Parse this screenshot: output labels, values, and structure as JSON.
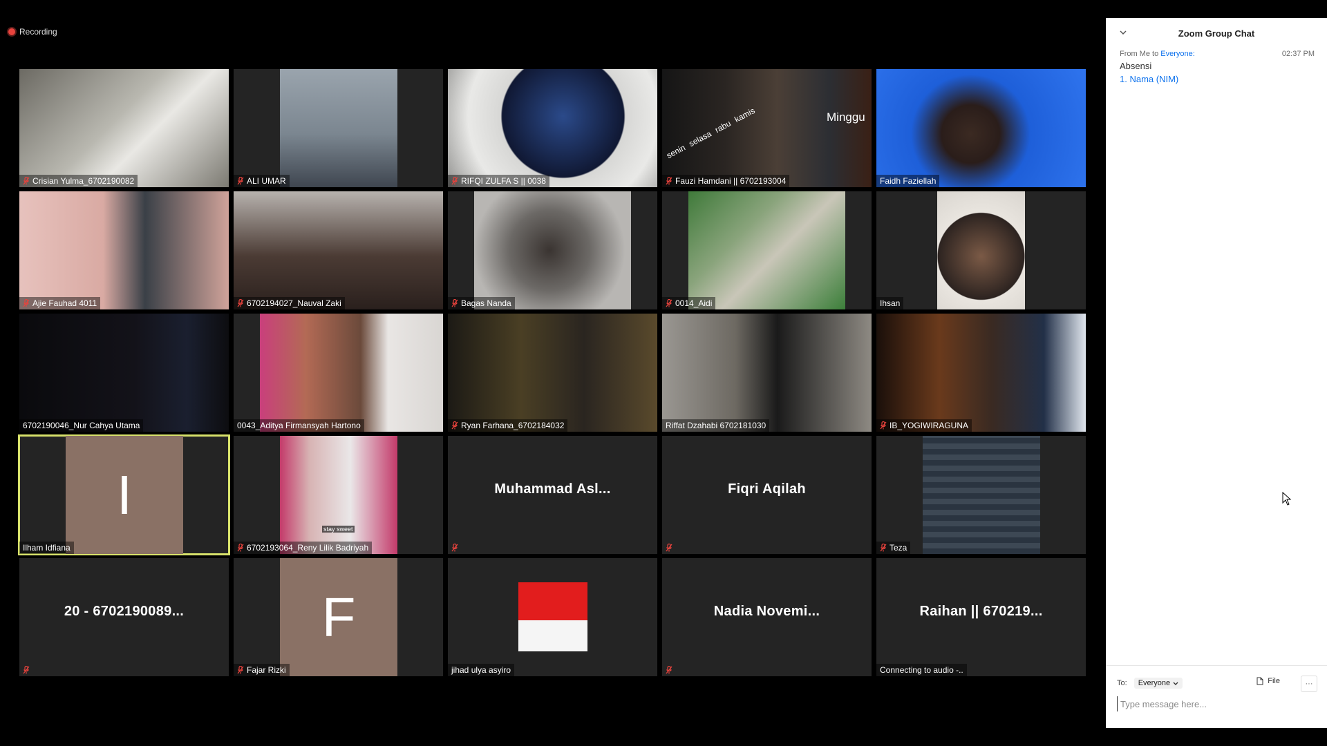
{
  "recording": {
    "label": "Recording"
  },
  "tiles": [
    {
      "name": "Crisian Yulma_6702190082",
      "muted": true
    },
    {
      "name": "ALI UMAR",
      "muted": true
    },
    {
      "name": "RIFQI ZULFA S || 0038",
      "muted": true
    },
    {
      "name": "Fauzi Hamdani || 6702193004",
      "muted": true
    },
    {
      "name": "Faidh Faziellah",
      "muted": false
    },
    {
      "name": "Ajie Fauhad 4011",
      "muted": true
    },
    {
      "name": "6702194027_Nauval Zaki",
      "muted": true
    },
    {
      "name": "Bagas Nanda",
      "muted": true
    },
    {
      "name": "0014_Aidi",
      "muted": true
    },
    {
      "name": "Ihsan",
      "muted": false
    },
    {
      "name": "6702190046_Nur Cahya Utama",
      "muted": false
    },
    {
      "name": "0043_Aditya Firmansyah Hartono",
      "muted": false
    },
    {
      "name": "Ryan Farhana_6702184032",
      "muted": true
    },
    {
      "name": "Riffat Dzahabi 6702181030",
      "muted": false
    },
    {
      "name": "IB_YOGIWIRAGUNA",
      "muted": true
    },
    {
      "name": "Ilham Idfiana",
      "muted": false,
      "letter": "I"
    },
    {
      "name": "6702193064_Reny Lilik Badriyah",
      "muted": true
    },
    {
      "name": "",
      "muted": true,
      "big": "Muhammad  Asl..."
    },
    {
      "name": "",
      "muted": true,
      "big": "Fiqri Aqilah"
    },
    {
      "name": "Teza",
      "muted": true
    },
    {
      "name": "",
      "muted": true,
      "big": "20 - 6702190089..."
    },
    {
      "name": "Fajar Rizki",
      "muted": true,
      "letter": "F"
    },
    {
      "name": "jihad ulya asyiro",
      "muted": false
    },
    {
      "name": "",
      "muted": true,
      "big": "Nadia  Novemi..."
    },
    {
      "name": "Connecting to audio -..",
      "muted": false,
      "big": "Raihan || 670219..."
    }
  ],
  "tile_overlays": {
    "fauzi_text": "Minggu",
    "fauzi_days": [
      "senin",
      "selasa",
      "rabu",
      "kamis"
    ],
    "reny_caption": "stay sweet"
  },
  "chat": {
    "title": "Zoom Group Chat",
    "message": {
      "from": "From Me to",
      "to": "Everyone:",
      "time": "02:37 PM",
      "lines": [
        "Absensi",
        "1. Nama (NIM)"
      ]
    },
    "footer": {
      "to_label": "To:",
      "recipient": "Everyone",
      "file_label": "File",
      "more_label": "···",
      "placeholder": "Type message here..."
    }
  },
  "colors": {
    "active_speaker": "#d8e26b",
    "muted_icon": "#e8433d",
    "link": "#0e72ed"
  }
}
